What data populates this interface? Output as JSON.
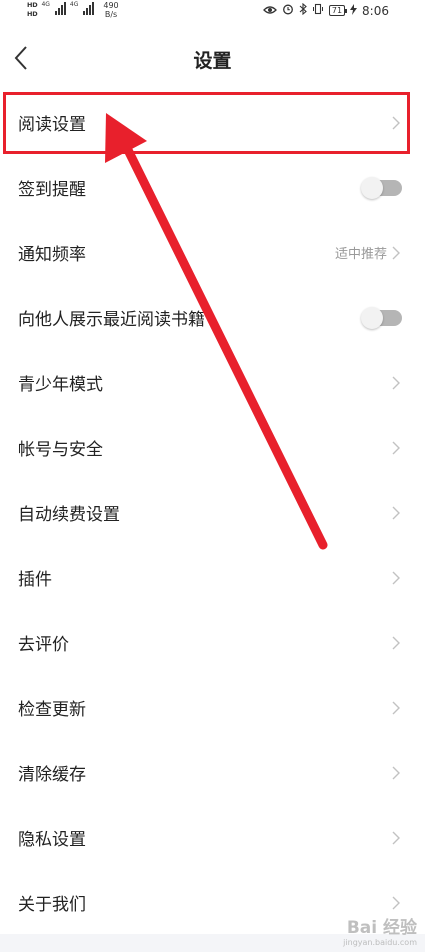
{
  "status_bar": {
    "hd1": "HD",
    "hd2": "HD",
    "net1": "4G",
    "net2": "4G",
    "speed_value": "490",
    "speed_unit": "B/s",
    "battery": "71",
    "time": "8:06"
  },
  "header": {
    "title": "设置"
  },
  "settings": {
    "reading": {
      "label": "阅读设置"
    },
    "checkin": {
      "label": "签到提醒",
      "enabled": false
    },
    "notify": {
      "label": "通知频率",
      "value": "适中推荐"
    },
    "show_bookmark": {
      "label": "向他人展示最近阅读书籍",
      "enabled": false
    },
    "teen": {
      "label": "青少年模式"
    },
    "account": {
      "label": "帐号与安全"
    },
    "autorenew": {
      "label": "自动续费设置"
    },
    "plugins": {
      "label": "插件"
    },
    "rate": {
      "label": "去评价"
    },
    "update": {
      "label": "检查更新"
    },
    "cache": {
      "label": "清除缓存"
    },
    "privacy": {
      "label": "隐私设置"
    },
    "about": {
      "label": "关于我们"
    }
  },
  "annotation": {
    "color": "#e8202c"
  },
  "watermark": {
    "logo": "Bai 经验",
    "url": "jingyan.baidu.com"
  }
}
